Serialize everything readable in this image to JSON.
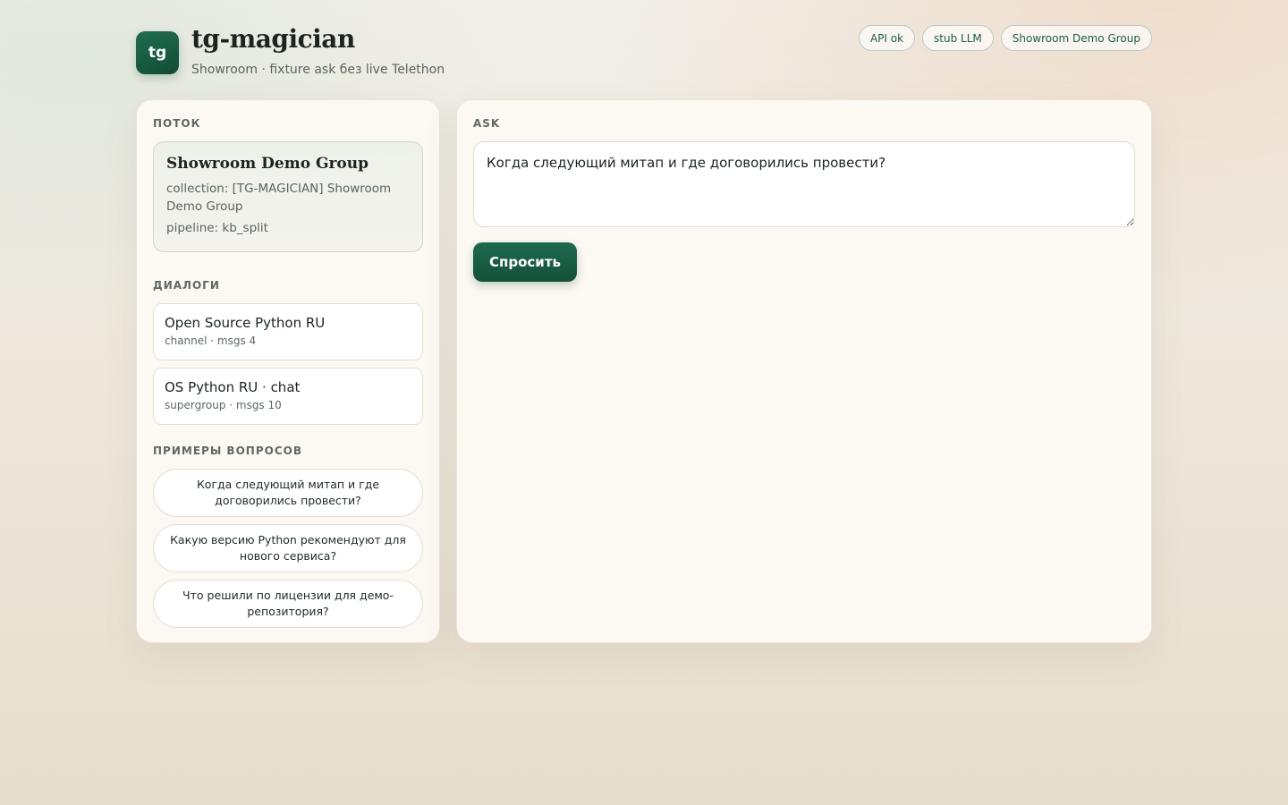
{
  "header": {
    "logo_text": "tg",
    "title": "tg-magician",
    "subtitle": "Showroom · fixture ask без live Telethon",
    "badges": [
      "API ok",
      "stub LLM",
      "Showroom Demo Group"
    ]
  },
  "sidebar": {
    "stream_label": "Поток",
    "stream": {
      "name": "Showroom Demo Group",
      "collection": "collection: [TG-MAGICIAN] Showroom Demo Group",
      "pipeline": "pipeline: kb_split"
    },
    "dialogs_label": "Диалоги",
    "dialogs": [
      {
        "title": "Open Source Python RU",
        "sub": "channel · msgs 4"
      },
      {
        "title": "OS Python RU · chat",
        "sub": "supergroup · msgs 10"
      }
    ],
    "examples_label": "Примеры вопросов",
    "examples": [
      "Когда следующий митап и где договорились провести?",
      "Какую версию Python рекомендуют для нового сервиса?",
      "Что решили по лицензии для демо-репозитория?"
    ]
  },
  "main": {
    "ask_label": "Ask",
    "ask_value": "Когда следующий митап и где договорились провести?",
    "ask_button": "Спросить"
  },
  "colors": {
    "accent": "#1a5c44",
    "panel_bg": "#fcf9f2",
    "badge_text": "#1d5e45"
  }
}
